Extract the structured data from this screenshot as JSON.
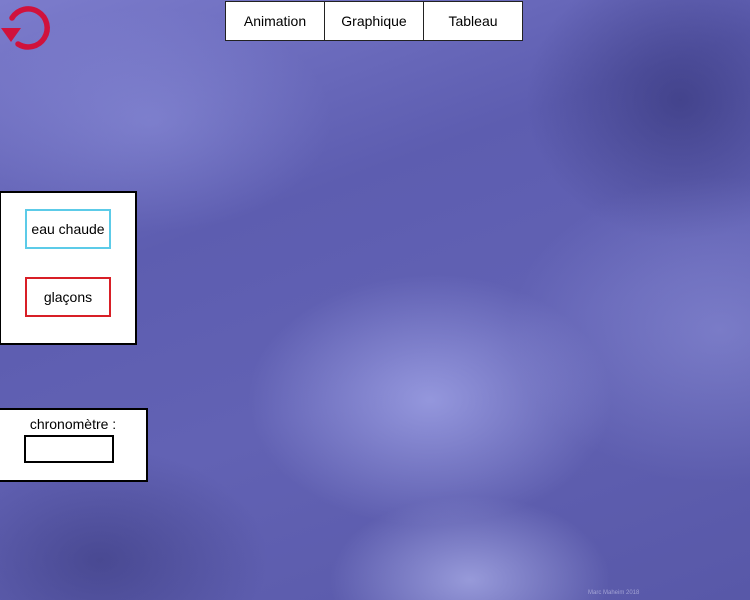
{
  "toolbar": {
    "reset_icon": "reset-arrow-icon",
    "reset_color": "#d0123c"
  },
  "tabs": [
    {
      "label": "Animation"
    },
    {
      "label": "Graphique"
    },
    {
      "label": "Tableau"
    }
  ],
  "actions": {
    "hot_water_label": "eau chaude",
    "hot_water_border_color": "#5ccbe8",
    "ice_label": "glaçons",
    "ice_border_color": "#d81f26"
  },
  "chrono": {
    "label": "chronomètre :",
    "value": ""
  },
  "footer": {
    "credit": "Marc Maheim 2018"
  }
}
